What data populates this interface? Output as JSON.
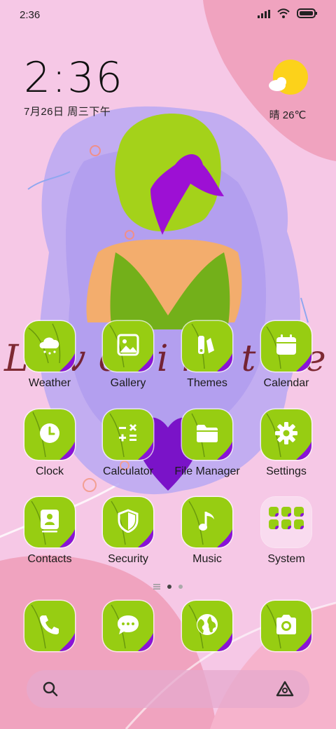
{
  "status_bar": {
    "time": "2:36",
    "icons": [
      "signal-icon",
      "wifi-icon",
      "battery-icon"
    ]
  },
  "clock_widget": {
    "time": "2:36",
    "date": "7月26日 周三下午"
  },
  "weather_widget": {
    "icon": "sun-cloud-icon",
    "text": "晴 26℃"
  },
  "wallpaper": {
    "script_text": "Live in the moment",
    "colors": {
      "pink": "#f6c8e6",
      "lavender": "#b3a2f0",
      "rose": "#f0a3bf",
      "hair": "#a4d21a",
      "ribbon": "#9d10d4",
      "dress": "#73b01a",
      "skin": "#f3ad6d"
    }
  },
  "apps": {
    "row1": [
      {
        "label": "Weather",
        "icon": "weather-cloud-icon"
      },
      {
        "label": "Gallery",
        "icon": "image-icon"
      },
      {
        "label": "Themes",
        "icon": "theme-brush-icon"
      },
      {
        "label": "Calendar",
        "icon": "calendar-icon"
      }
    ],
    "row2": [
      {
        "label": "Clock",
        "icon": "clock-icon"
      },
      {
        "label": "Calculator",
        "icon": "calculator-icon"
      },
      {
        "label": "File Manager",
        "icon": "folder-icon"
      },
      {
        "label": "Settings",
        "icon": "gear-icon"
      }
    ],
    "row3": [
      {
        "label": "Contacts",
        "icon": "contacts-icon"
      },
      {
        "label": "Security",
        "icon": "shield-icon"
      },
      {
        "label": "Music",
        "icon": "music-note-icon"
      },
      {
        "label": "System",
        "icon": "folder-grid-icon"
      }
    ]
  },
  "page_indicator": {
    "pages": 2,
    "current": 1
  },
  "dock": [
    {
      "icon": "phone-icon"
    },
    {
      "icon": "message-icon"
    },
    {
      "icon": "browser-globe-icon"
    },
    {
      "icon": "camera-icon"
    }
  ],
  "search_bar": {
    "icons": [
      "search-icon",
      "assistant-icon"
    ]
  },
  "icon_colors": {
    "tile": "#97cd12",
    "accent": "#8a12d8",
    "glyph": "#ffffff"
  }
}
